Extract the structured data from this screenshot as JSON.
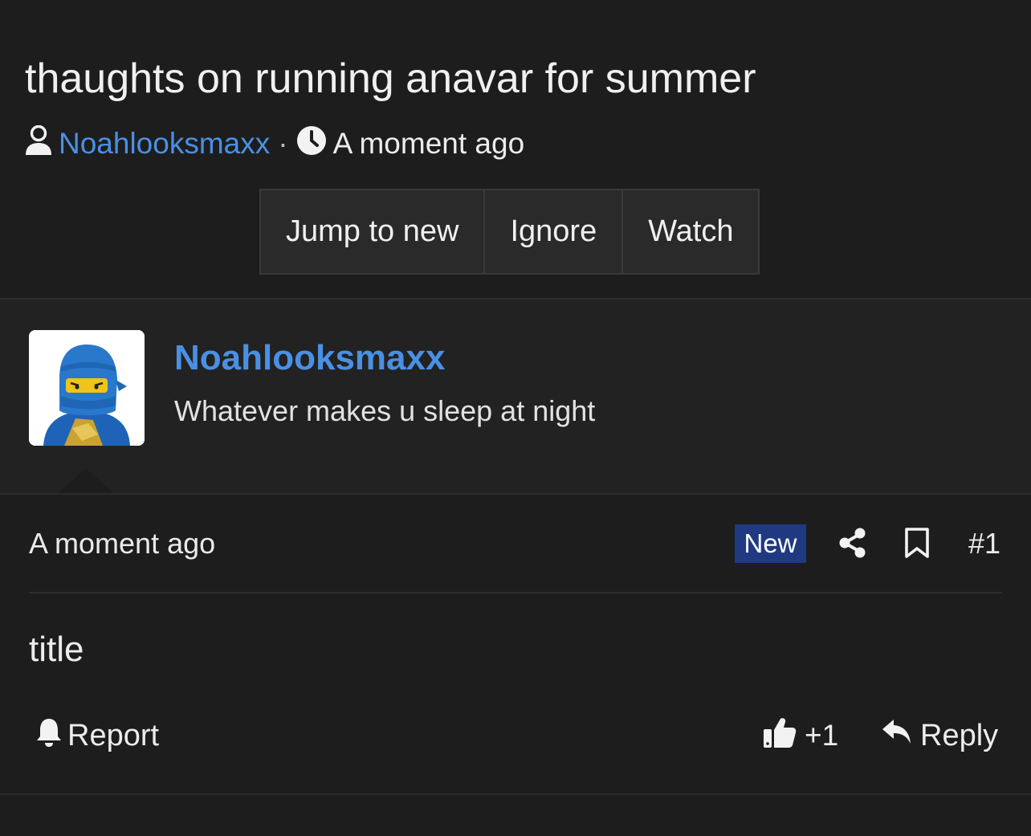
{
  "thread": {
    "title": "thaughts on running anavar for summer",
    "author": "Noahlooksmaxx",
    "separator": "·",
    "time": "A moment ago",
    "buttons": {
      "jump_to_new": "Jump to new",
      "ignore": "Ignore",
      "watch": "Watch"
    }
  },
  "post": {
    "username": "Noahlooksmaxx",
    "user_title": "Whatever makes u sleep at night",
    "time": "A moment ago",
    "badge": "New",
    "number": "#1",
    "content": "title",
    "footer": {
      "report": "Report",
      "like_count": "+1",
      "reply": "Reply"
    }
  },
  "colors": {
    "background": "#1d1d1e",
    "link": "#4a90e2",
    "badge": "#1f3a80"
  },
  "icons": [
    "user-icon",
    "clock-icon",
    "share-icon",
    "bookmark-icon",
    "bell-icon",
    "thumbs-up-icon",
    "reply-icon"
  ]
}
